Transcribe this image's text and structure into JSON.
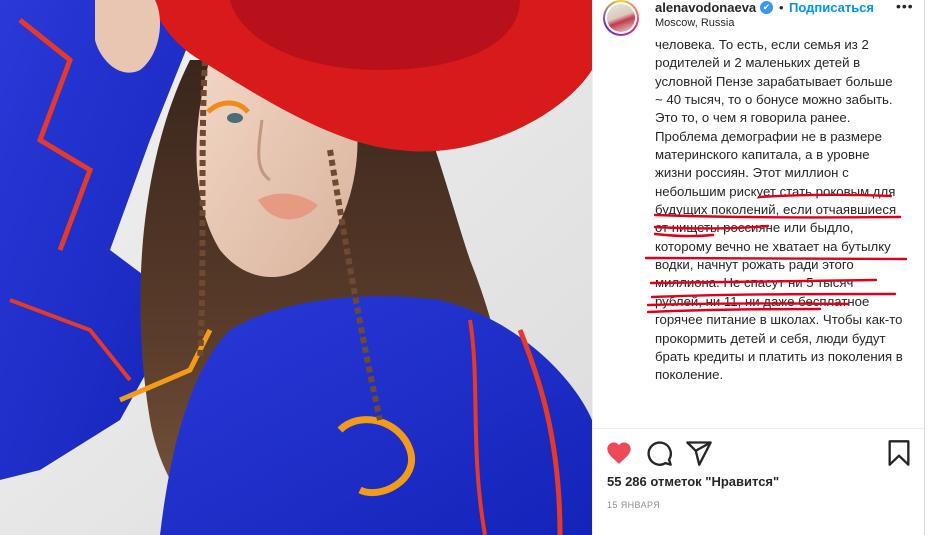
{
  "post": {
    "username": "alenavodonaeva",
    "verified_mark": "✔",
    "separator": "•",
    "follow_label": "Подписаться",
    "location": "Moscow, Russia",
    "more_label": "•••",
    "caption_paragraphs": [
      "человека. То есть, если семья из 2 родителей и 2 маленьких детей в условной Пензе зарабатывает больше ~ 40 тысяч, то о бонусе можно забыть.",
      "Это то, о чем я говорила ранее. Проблема демографии не в размере материнского капитала, а в уровне жизни россиян. Этот миллион с небольшим рискует стать роковым для будущих поколений, если отчаявшиеся от нищеты россияне или быдло, которому вечно не хватает на бутылку водки, начнут рожать ради этого миллиона. Не спасут ни 5 тысяч рублей, ни 11, ни даже бесплатное горячее питание в школах. Чтобы как-то прокормить детей и себя, люди будут брать кредиты и платить из поколения в поколение."
    ],
    "likes_text": "55 286 отметок \"Нравится\"",
    "date": "15 ЯНВАРЯ",
    "actions": {
      "like_icon": "heart-icon",
      "comment_icon": "comment-icon",
      "share_icon": "paper-plane-icon",
      "save_icon": "bookmark-icon"
    },
    "colors": {
      "like": "#ed4956",
      "link": "#0095f6",
      "verified": "#3897f0",
      "scribble": "#e0001a",
      "text": "#262626",
      "muted": "#8e8e8e"
    }
  }
}
